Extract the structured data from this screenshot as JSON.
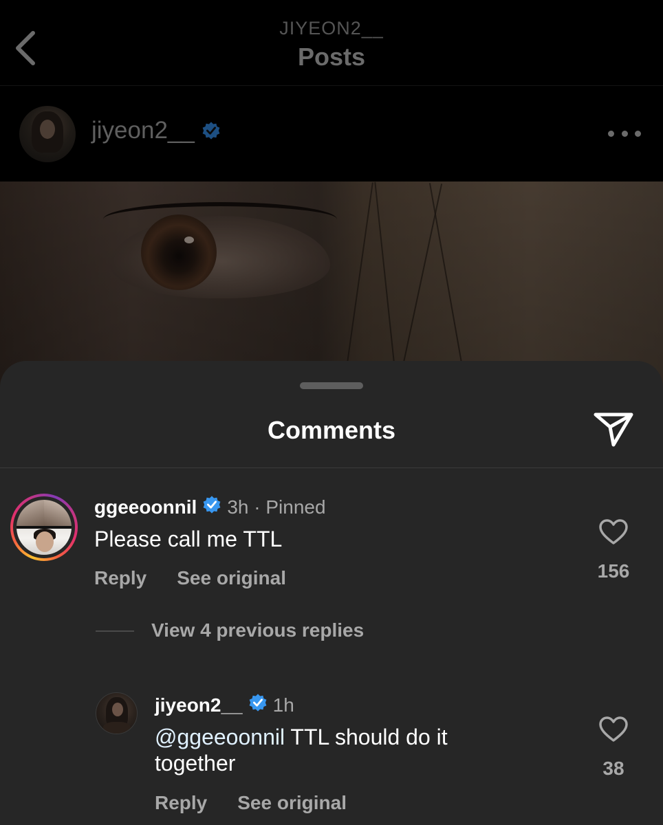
{
  "header": {
    "subtitle": "JIYEON2__",
    "title": "Posts"
  },
  "post": {
    "username": "jiyeon2__"
  },
  "comments_sheet": {
    "title": "Comments",
    "comments": [
      {
        "username": "ggeeoonnil",
        "time": "3h · Pinned",
        "text": "Please call me TTL",
        "reply_label": "Reply",
        "see_original_label": "See original",
        "likes": "156"
      }
    ],
    "view_replies_label": "View 4 previous replies",
    "replies": [
      {
        "username": "jiyeon2__",
        "time": "1h",
        "mention": "@ggeeoonnil",
        "text": " TTL should do it together",
        "reply_label": "Reply",
        "see_original_label": "See original",
        "likes": "38"
      }
    ]
  },
  "colors": {
    "sheet_bg": "#262626",
    "verified_blue": "#3897f0",
    "muted_text": "#a8a8a8"
  }
}
